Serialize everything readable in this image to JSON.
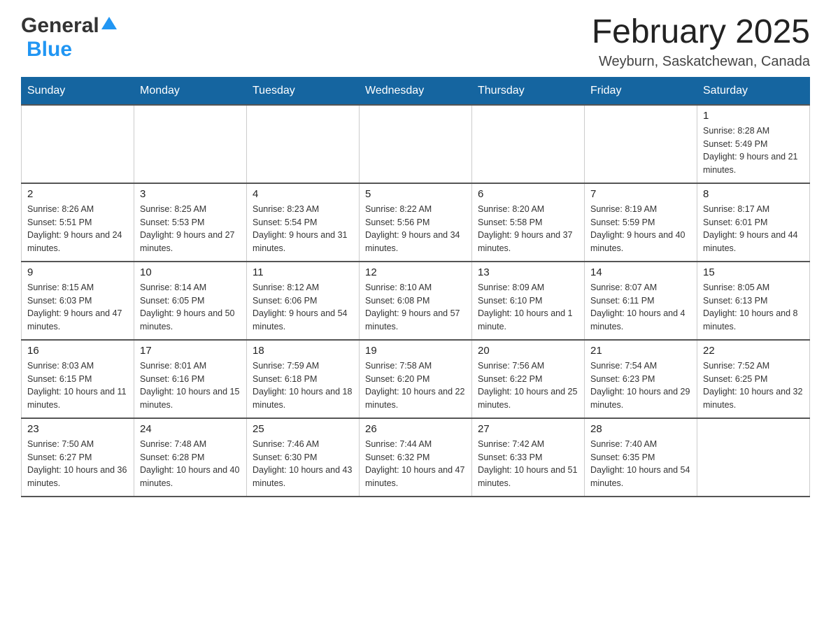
{
  "header": {
    "logo_general": "General",
    "logo_blue": "Blue",
    "month_title": "February 2025",
    "location": "Weyburn, Saskatchewan, Canada"
  },
  "days_of_week": [
    "Sunday",
    "Monday",
    "Tuesday",
    "Wednesday",
    "Thursday",
    "Friday",
    "Saturday"
  ],
  "weeks": [
    [
      {
        "day": "",
        "info": ""
      },
      {
        "day": "",
        "info": ""
      },
      {
        "day": "",
        "info": ""
      },
      {
        "day": "",
        "info": ""
      },
      {
        "day": "",
        "info": ""
      },
      {
        "day": "",
        "info": ""
      },
      {
        "day": "1",
        "info": "Sunrise: 8:28 AM\nSunset: 5:49 PM\nDaylight: 9 hours and 21 minutes."
      }
    ],
    [
      {
        "day": "2",
        "info": "Sunrise: 8:26 AM\nSunset: 5:51 PM\nDaylight: 9 hours and 24 minutes."
      },
      {
        "day": "3",
        "info": "Sunrise: 8:25 AM\nSunset: 5:53 PM\nDaylight: 9 hours and 27 minutes."
      },
      {
        "day": "4",
        "info": "Sunrise: 8:23 AM\nSunset: 5:54 PM\nDaylight: 9 hours and 31 minutes."
      },
      {
        "day": "5",
        "info": "Sunrise: 8:22 AM\nSunset: 5:56 PM\nDaylight: 9 hours and 34 minutes."
      },
      {
        "day": "6",
        "info": "Sunrise: 8:20 AM\nSunset: 5:58 PM\nDaylight: 9 hours and 37 minutes."
      },
      {
        "day": "7",
        "info": "Sunrise: 8:19 AM\nSunset: 5:59 PM\nDaylight: 9 hours and 40 minutes."
      },
      {
        "day": "8",
        "info": "Sunrise: 8:17 AM\nSunset: 6:01 PM\nDaylight: 9 hours and 44 minutes."
      }
    ],
    [
      {
        "day": "9",
        "info": "Sunrise: 8:15 AM\nSunset: 6:03 PM\nDaylight: 9 hours and 47 minutes."
      },
      {
        "day": "10",
        "info": "Sunrise: 8:14 AM\nSunset: 6:05 PM\nDaylight: 9 hours and 50 minutes."
      },
      {
        "day": "11",
        "info": "Sunrise: 8:12 AM\nSunset: 6:06 PM\nDaylight: 9 hours and 54 minutes."
      },
      {
        "day": "12",
        "info": "Sunrise: 8:10 AM\nSunset: 6:08 PM\nDaylight: 9 hours and 57 minutes."
      },
      {
        "day": "13",
        "info": "Sunrise: 8:09 AM\nSunset: 6:10 PM\nDaylight: 10 hours and 1 minute."
      },
      {
        "day": "14",
        "info": "Sunrise: 8:07 AM\nSunset: 6:11 PM\nDaylight: 10 hours and 4 minutes."
      },
      {
        "day": "15",
        "info": "Sunrise: 8:05 AM\nSunset: 6:13 PM\nDaylight: 10 hours and 8 minutes."
      }
    ],
    [
      {
        "day": "16",
        "info": "Sunrise: 8:03 AM\nSunset: 6:15 PM\nDaylight: 10 hours and 11 minutes."
      },
      {
        "day": "17",
        "info": "Sunrise: 8:01 AM\nSunset: 6:16 PM\nDaylight: 10 hours and 15 minutes."
      },
      {
        "day": "18",
        "info": "Sunrise: 7:59 AM\nSunset: 6:18 PM\nDaylight: 10 hours and 18 minutes."
      },
      {
        "day": "19",
        "info": "Sunrise: 7:58 AM\nSunset: 6:20 PM\nDaylight: 10 hours and 22 minutes."
      },
      {
        "day": "20",
        "info": "Sunrise: 7:56 AM\nSunset: 6:22 PM\nDaylight: 10 hours and 25 minutes."
      },
      {
        "day": "21",
        "info": "Sunrise: 7:54 AM\nSunset: 6:23 PM\nDaylight: 10 hours and 29 minutes."
      },
      {
        "day": "22",
        "info": "Sunrise: 7:52 AM\nSunset: 6:25 PM\nDaylight: 10 hours and 32 minutes."
      }
    ],
    [
      {
        "day": "23",
        "info": "Sunrise: 7:50 AM\nSunset: 6:27 PM\nDaylight: 10 hours and 36 minutes."
      },
      {
        "day": "24",
        "info": "Sunrise: 7:48 AM\nSunset: 6:28 PM\nDaylight: 10 hours and 40 minutes."
      },
      {
        "day": "25",
        "info": "Sunrise: 7:46 AM\nSunset: 6:30 PM\nDaylight: 10 hours and 43 minutes."
      },
      {
        "day": "26",
        "info": "Sunrise: 7:44 AM\nSunset: 6:32 PM\nDaylight: 10 hours and 47 minutes."
      },
      {
        "day": "27",
        "info": "Sunrise: 7:42 AM\nSunset: 6:33 PM\nDaylight: 10 hours and 51 minutes."
      },
      {
        "day": "28",
        "info": "Sunrise: 7:40 AM\nSunset: 6:35 PM\nDaylight: 10 hours and 54 minutes."
      },
      {
        "day": "",
        "info": ""
      }
    ]
  ]
}
